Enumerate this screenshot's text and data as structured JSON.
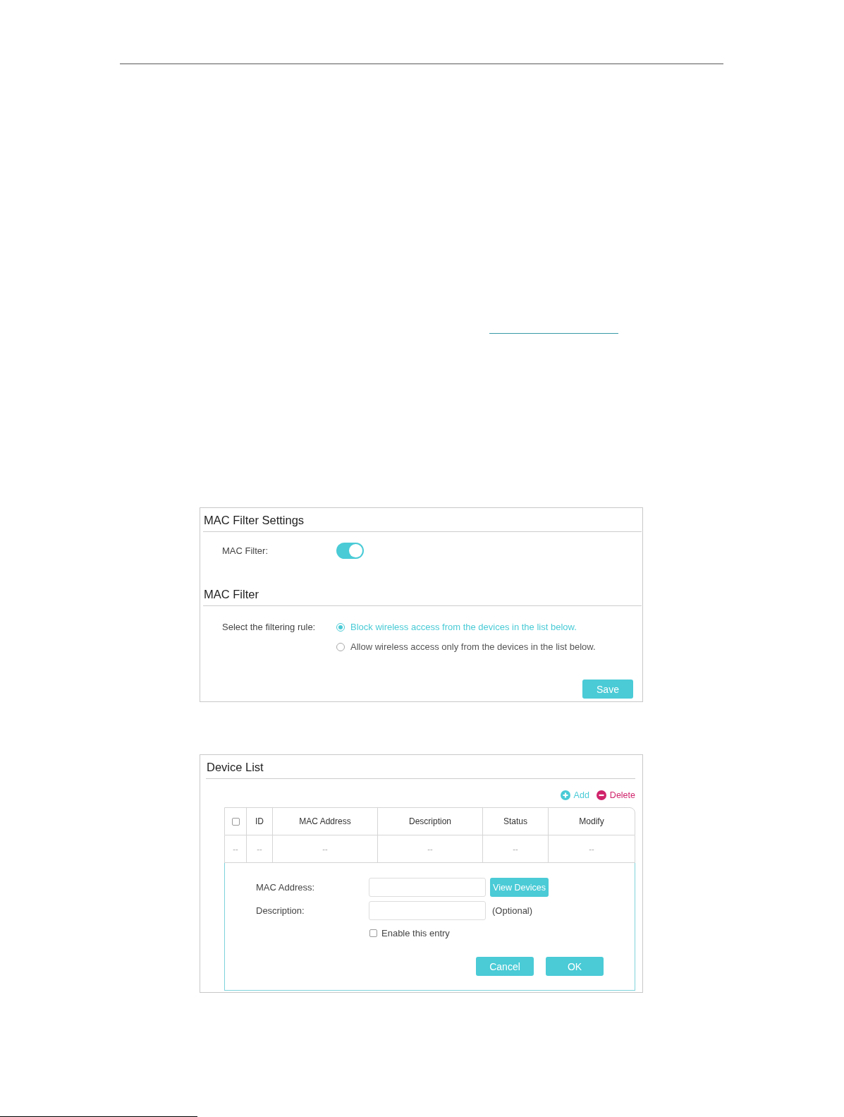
{
  "mac_filter_settings": {
    "title": "MAC Filter Settings",
    "mac_filter": {
      "label": "MAC Filter:",
      "on": true
    }
  },
  "mac_filter": {
    "title": "MAC Filter",
    "rule_label": "Select the filtering rule:",
    "options": [
      {
        "label": "Block wireless access from the devices in the list below.",
        "selected": true
      },
      {
        "label": "Allow wireless access only from the devices in the list below.",
        "selected": false
      }
    ],
    "save_button": "Save"
  },
  "device_list": {
    "title": "Device List",
    "actions": [
      {
        "kind": "add",
        "label": "Add"
      },
      {
        "kind": "delete",
        "label": "Delete"
      }
    ],
    "table": {
      "columns": [
        {
          "kind": "checkbox",
          "checked": false
        },
        {
          "kind": "text",
          "label": "ID"
        },
        {
          "kind": "text",
          "label": "MAC Address"
        },
        {
          "kind": "text",
          "label": "Description"
        },
        {
          "kind": "text",
          "label": "Status"
        },
        {
          "kind": "text",
          "label": "Modify"
        }
      ],
      "rows": [
        {
          "cells": [
            "--",
            "--",
            "--",
            "--",
            "--",
            "--"
          ]
        }
      ]
    },
    "form": {
      "fields": [
        {
          "label": "MAC Address:",
          "button": "View Devices"
        },
        {
          "label": "Description:",
          "note": "(Optional)"
        }
      ],
      "enable_entry": {
        "label": "Enable this entry",
        "checked": false
      },
      "buttons": [
        "Cancel",
        "OK"
      ]
    }
  }
}
